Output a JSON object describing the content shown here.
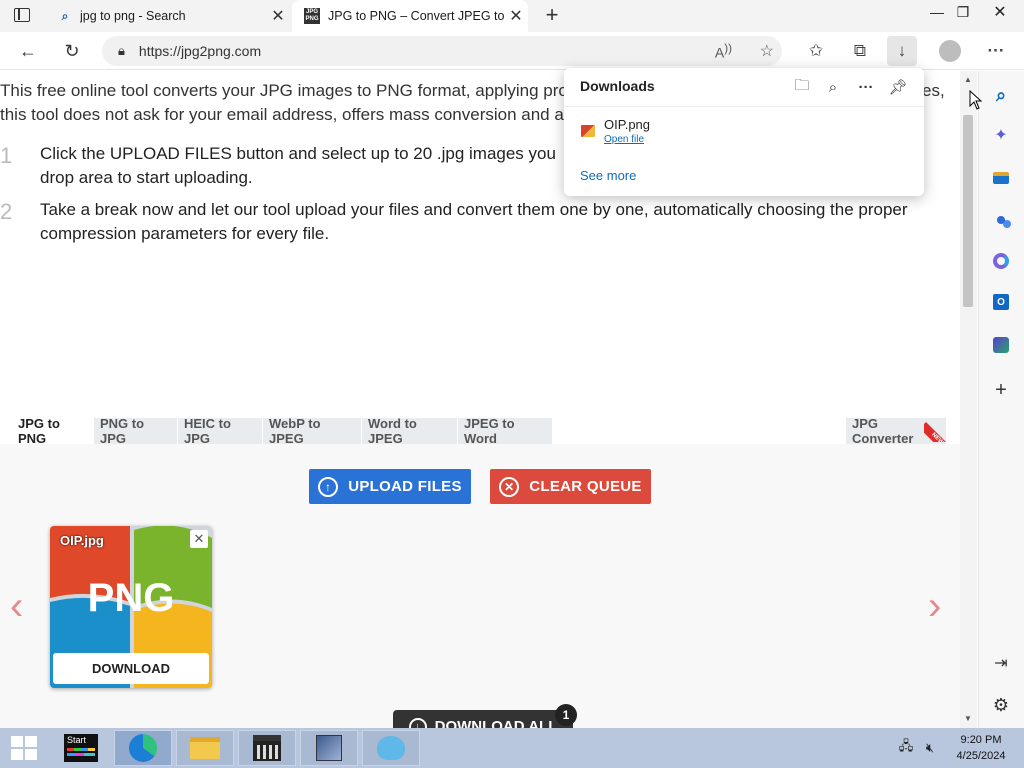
{
  "browser": {
    "tabs": [
      {
        "title": "jpg to png - Search",
        "active": false
      },
      {
        "title": "JPG to PNG – Convert JPEG to P",
        "active": true
      }
    ],
    "address": "https://jpg2png.com",
    "new_tab_symbol": "+"
  },
  "page": {
    "intro_line1": "This free online tool converts your JPG images to PNG format, applying pro",
    "intro_line1_end": "es,",
    "intro_line2": "this tool does not ask for your email address, offers mass conversion and a",
    "steps": [
      {
        "num": "1",
        "line1": "Click the UPLOAD FILES button and select up to 20 .jpg images you",
        "line2": "drop area to start uploading."
      },
      {
        "num": "2",
        "line1": "Take a break now and let our tool upload your files and convert them one by one, automatically choosing the proper",
        "line2": "compression parameters for every file."
      }
    ],
    "tool_tabs": [
      "JPG to PNG",
      "PNG to JPG",
      "HEIC to JPG",
      "WebP to JPEG",
      "Word to JPEG",
      "JPEG to Word"
    ],
    "tool_tab_right": "JPG Converter",
    "new_ribbon": "NEW",
    "upload_label": "UPLOAD FILES",
    "clear_label": "CLEAR QUEUE",
    "thumb": {
      "filename": "OIP.jpg",
      "format": "PNG",
      "download_label": "DOWNLOAD"
    },
    "download_all_label": "DOWNLOAD ALL",
    "download_all_count": "1"
  },
  "downloads_panel": {
    "title": "Downloads",
    "file_name": "OIP.png",
    "open_file_label": "Open file",
    "see_more_label": "See more"
  },
  "taskbar": {
    "start_label": "Start",
    "time": "9:20 PM",
    "date": "4/25/2024"
  },
  "colors": {
    "upload_button": "#2b72d6",
    "clear_button": "#dc4a3d",
    "link": "#0f6cbd",
    "taskbar": "#b8c7dd"
  }
}
